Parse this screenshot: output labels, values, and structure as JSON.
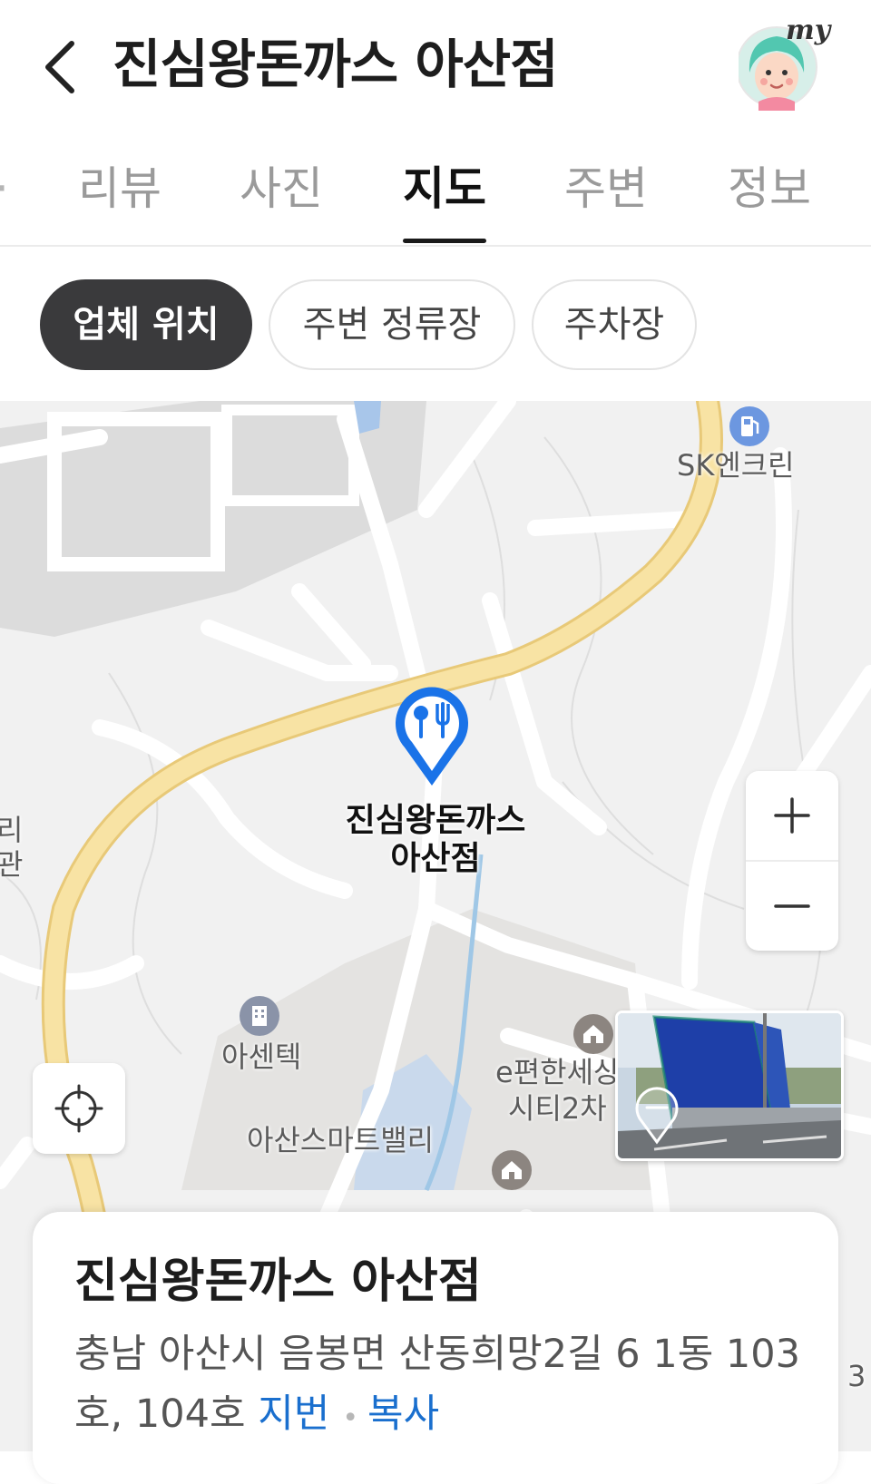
{
  "header": {
    "title": "진심왕돈까스 아산점",
    "my_label": "my"
  },
  "tabs": [
    {
      "label": "리뷰",
      "active": false
    },
    {
      "label": "사진",
      "active": false
    },
    {
      "label": "지도",
      "active": true
    },
    {
      "label": "주변",
      "active": false
    },
    {
      "label": "정보",
      "active": false
    }
  ],
  "chips": [
    {
      "label": "업체 위치",
      "active": true
    },
    {
      "label": "주변 정류장",
      "active": false
    },
    {
      "label": "주차장",
      "active": false
    }
  ],
  "map": {
    "place_pin_label_line1": "진심왕돈까스",
    "place_pin_label_line2": "아산점",
    "labels": {
      "gas_station": "SK엔크린",
      "company": "아센텍",
      "apartment_line1": "e편한세상",
      "apartment_line2": "시티2차",
      "complex": "아산스마트밸리",
      "left_edge_1": "리",
      "left_edge_2": "관",
      "right_edge": "3"
    },
    "colors": {
      "pin": "#1a73e8",
      "main_road": "#f7e1a0",
      "park": "#d4d4d4",
      "water": "#a8c6ea"
    }
  },
  "card": {
    "title": "진심왕돈까스 아산점",
    "address": "충남 아산시 음봉면 산동희망2길 6 1동 103호, 104호",
    "jibun_link": "지번",
    "copy_link": "복사"
  }
}
